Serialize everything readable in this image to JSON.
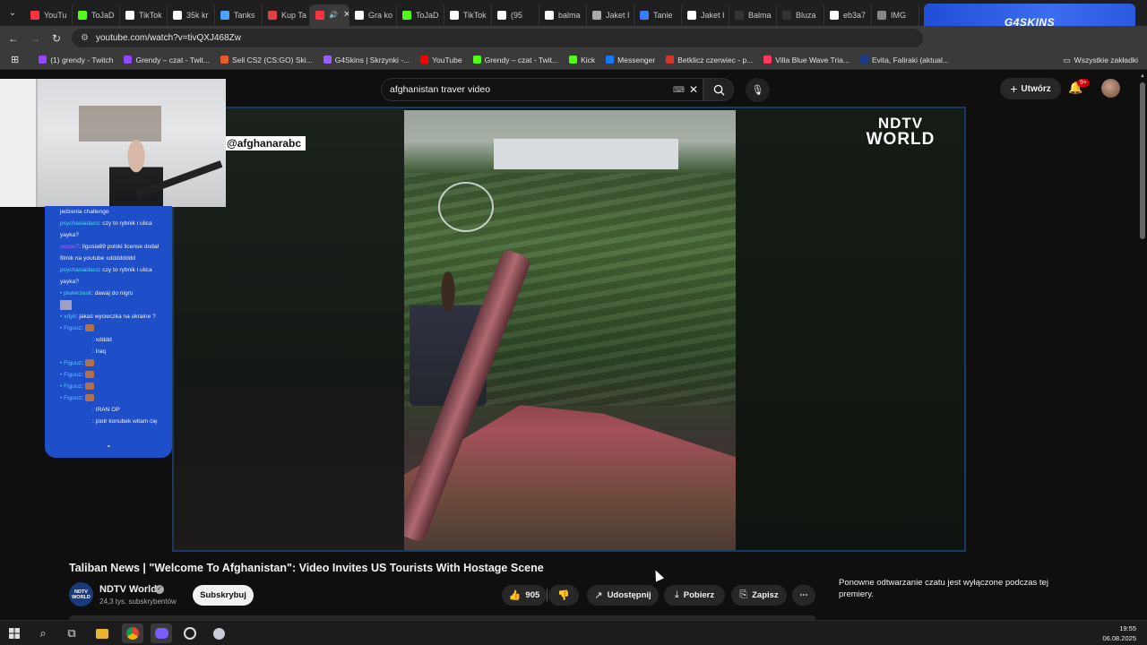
{
  "browser": {
    "tabs": [
      {
        "label": "YouTu",
        "color": "#ff3040"
      },
      {
        "label": "ToJaD",
        "color": "#53fc18"
      },
      {
        "label": "TikTok",
        "color": "#ffffff"
      },
      {
        "label": "35k kr",
        "color": "#ffffff"
      },
      {
        "label": "Tanks",
        "color": "#4aa3ff"
      },
      {
        "label": "Kup Ta",
        "color": "#e04040"
      },
      {
        "label": "",
        "color": "#ff3040",
        "active": true
      },
      {
        "label": "Gra ko",
        "color": "#ffffff"
      },
      {
        "label": "ToJaD",
        "color": "#53fc18"
      },
      {
        "label": "TikTok",
        "color": "#ffffff"
      },
      {
        "label": "(95",
        "color": "#ffffff"
      },
      {
        "label": "balma",
        "color": "#ffffff"
      },
      {
        "label": "Jaket I",
        "color": "#aaaaaa"
      },
      {
        "label": "Tanie",
        "color": "#3a7bff"
      },
      {
        "label": "Jaket I",
        "color": "#ffffff"
      },
      {
        "label": "Balma",
        "color": "#333333"
      },
      {
        "label": "Bluza",
        "color": "#333333"
      },
      {
        "label": "eb3a7",
        "color": "#ffffff"
      },
      {
        "label": "IMG",
        "color": "#888888"
      }
    ],
    "tab_close": "✕",
    "promo": "G4SKINS",
    "url": "youtube.com/watch?v=tivQXJ468Zw",
    "bookmarks": [
      {
        "label": "(1) grendy - Twitch",
        "color": "#9146ff"
      },
      {
        "label": "Grendy – czat - Twit...",
        "color": "#9146ff"
      },
      {
        "label": "Sell CS2 (CS:GO) Ski...",
        "color": "#e85a2a"
      },
      {
        "label": "G4Skins | Skrzynki -...",
        "color": "#9a5cff"
      },
      {
        "label": "YouTube",
        "color": "#ff0000"
      },
      {
        "label": "Grendy – czat - Twit...",
        "color": "#53fc18"
      },
      {
        "label": "Kick",
        "color": "#53fc18"
      },
      {
        "label": "Messenger",
        "color": "#1877f2"
      },
      {
        "label": "Betklicz czerwiec - p...",
        "color": "#d4352a"
      },
      {
        "label": "Villa Blue Wave Tria...",
        "color": "#ff385c"
      },
      {
        "label": "Evita, Faliraki (aktual...",
        "color": "#1a3a8a"
      }
    ],
    "all_bookmarks": "Wszystkie zakładki"
  },
  "youtube": {
    "search_value": "afghanistan traver video",
    "create_label": "Utwórz",
    "notif_badge": "9+"
  },
  "video": {
    "watermark": "@afghanarabc",
    "logo_line1": "NDTV",
    "logo_line2": "WORLD",
    "title": "Taliban News | \"Welcome To Afghanistan\": Video Invites US Tourists With Hostage Scene",
    "channel_name": "NDTV World",
    "channel_avatar": "NDTV WORLD",
    "subscribers": "24,3 tys. subskrybentów",
    "subscribe_label": "Subskrybuj",
    "likes": "905",
    "share_label": "Udostępnij",
    "download_label": "Pobierz",
    "save_label": "Zapisz",
    "chat_disabled": "Ponowne odtwarzanie czatu jest wyłączone podczas tej premiery."
  },
  "chat": [
    {
      "user": "",
      "text": "jedzenia challenge",
      "ucls": "u1"
    },
    {
      "user": "psychasiadaco",
      "text": ": czy to rybnik i ulica yayka?",
      "ucls": "u1"
    },
    {
      "user": "vexoo7",
      "text": ": ligusia69 polski license dodał filmik na youtube xdddddddd",
      "ucls": "u3"
    },
    {
      "user": "psychasiadaco",
      "text": ": czy to rybnik i ulica yayka?",
      "ucls": "u1"
    },
    {
      "user": "piwierzesk",
      "text": ": dawaj do nigru",
      "ucls": "u1"
    },
    {
      "user": "xdyk",
      "text": ": jakaś wycieczka na ukraine ?",
      "ucls": "u2"
    },
    {
      "user": "Figuuz",
      "text": ":",
      "ucls": "u2"
    },
    {
      "user": "",
      "text": ": xdddd",
      "ucls": "u3"
    },
    {
      "user": "",
      "text": ": Iraq",
      "ucls": "u3"
    },
    {
      "user": "Figuuz",
      "text": ":",
      "ucls": "u2"
    },
    {
      "user": "Figuuz",
      "text": ":",
      "ucls": "u2"
    },
    {
      "user": "Figuuz",
      "text": ":",
      "ucls": "u2"
    },
    {
      "user": "Figuuz",
      "text": ":",
      "ucls": "u2"
    },
    {
      "user": "",
      "text": ": IRAN OP",
      "ucls": "u3"
    },
    {
      "user": "",
      "text": ": piotr konubek witam cię",
      "ucls": "u3"
    }
  ],
  "taskbar": {
    "time": "19:55",
    "date": "06.08.2025"
  }
}
